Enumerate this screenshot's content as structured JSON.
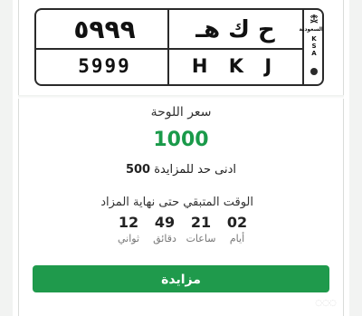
{
  "plate": {
    "number_ar": "٥٩٩٩",
    "letters_ar": "ح ك هـ",
    "number_en": "5999",
    "letters_en": "H K J",
    "band_ar": "السعودية",
    "band_ksa": [
      "K",
      "S",
      "A"
    ]
  },
  "price": {
    "label": "سعر اللوحة",
    "value": "1000"
  },
  "min_bid": {
    "text": "ادنى حد للمزايدة",
    "value": "500"
  },
  "countdown": {
    "title": "الوقت المتبقي حتى نهاية المزاد",
    "units": [
      {
        "value": "02",
        "label": "أيام"
      },
      {
        "value": "21",
        "label": "ساعات"
      },
      {
        "value": "49",
        "label": "دقائق"
      },
      {
        "value": "12",
        "label": "ثواني"
      }
    ]
  },
  "actions": {
    "bid_label": "مزايدة"
  },
  "colors": {
    "accent": "#1a9a4a",
    "button": "#1f9a4c"
  }
}
